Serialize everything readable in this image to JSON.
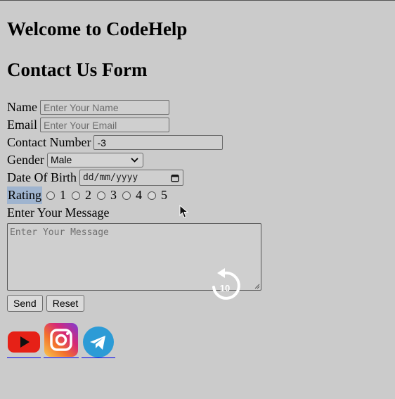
{
  "headings": {
    "welcome": "Welcome to CodeHelp",
    "form_title": "Contact Us Form"
  },
  "form": {
    "name": {
      "label": "Name",
      "placeholder": "Enter Your Name",
      "value": ""
    },
    "email": {
      "label": "Email",
      "placeholder": "Enter Your Email",
      "value": ""
    },
    "contact": {
      "label": "Contact Number",
      "value": "-3"
    },
    "gender": {
      "label": "Gender",
      "selected": "Male"
    },
    "dob": {
      "label": "Date Of Birth",
      "placeholder": "dd/mm/yyyy"
    },
    "rating": {
      "label": "Rating",
      "options": [
        "1",
        "2",
        "3",
        "4",
        "5"
      ]
    },
    "message": {
      "label": "Enter Your Message",
      "placeholder": "Enter Your Message"
    },
    "send_label": "Send",
    "reset_label": "Reset"
  },
  "socials": [
    "youtube-icon",
    "instagram-icon",
    "telegram-icon"
  ],
  "overlay": {
    "replay_seconds": "10"
  },
  "colors": {
    "background": "#cbcbcb",
    "rating_highlight": "#9fb4cf",
    "youtube": "#e62117",
    "telegram": "#2c9bd6"
  }
}
